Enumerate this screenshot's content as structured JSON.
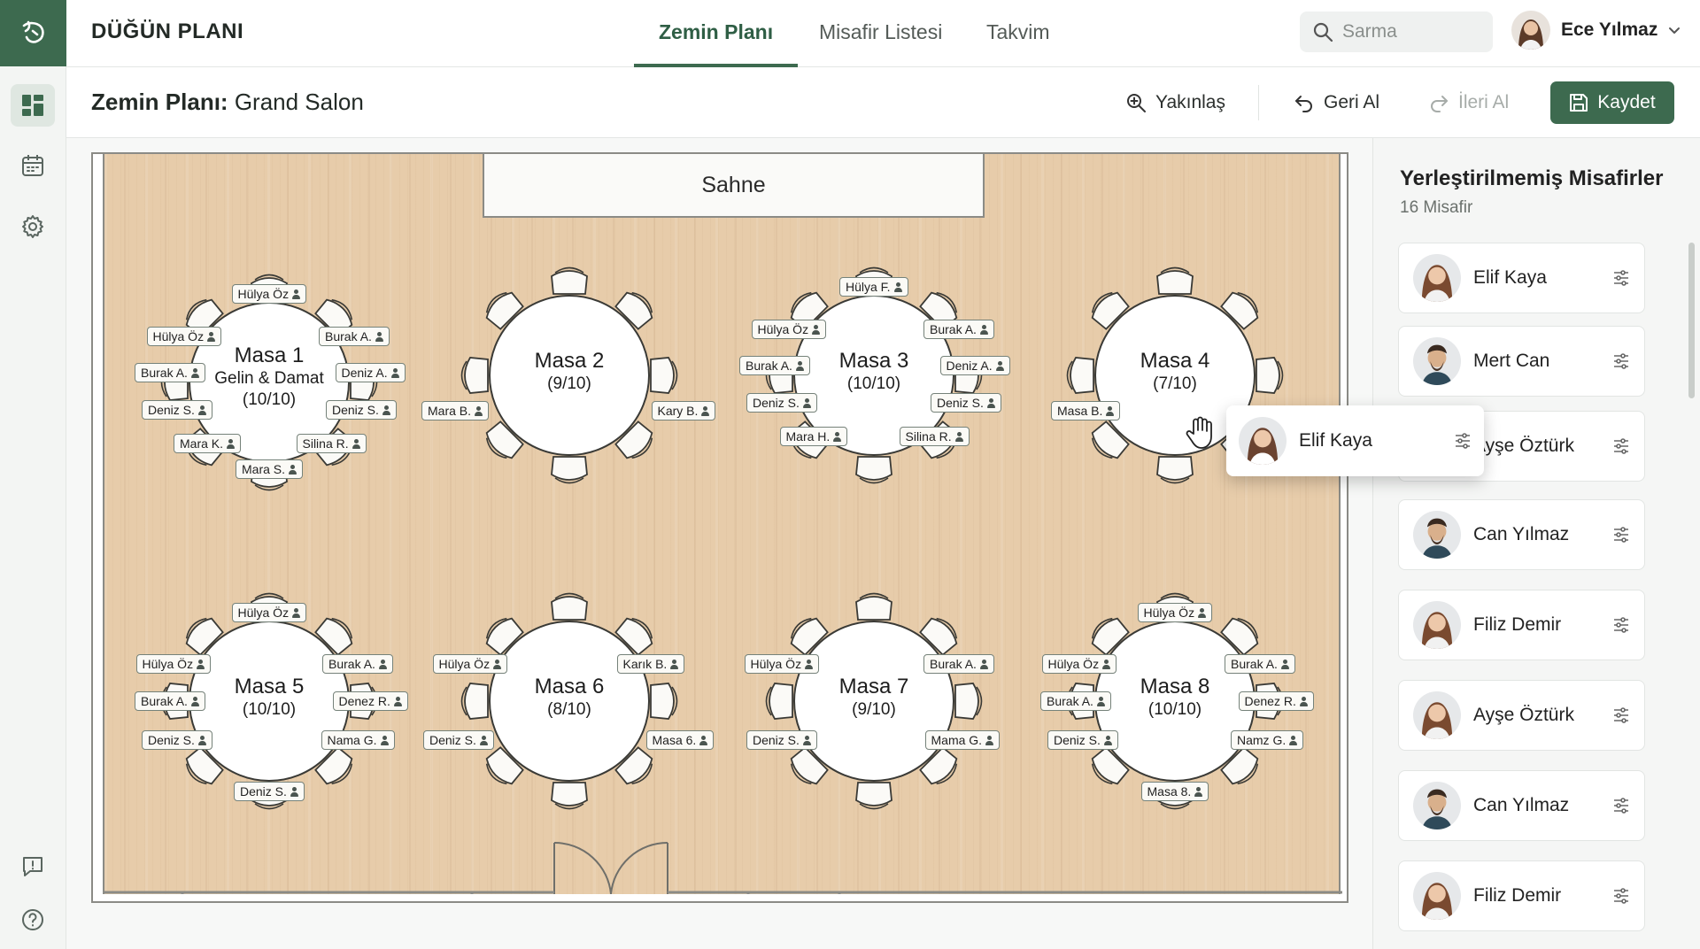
{
  "app": {
    "title": "DÜĞÜN PLANI"
  },
  "nav_tabs": [
    {
      "label": "Zemin Planı",
      "active": true
    },
    {
      "label": "Misafir Listesi",
      "active": false
    },
    {
      "label": "Takvim",
      "active": false
    }
  ],
  "search": {
    "placeholder": "Sarma"
  },
  "user": {
    "name": "Ece Yılmaz"
  },
  "toolbar": {
    "title_prefix": "Zemin Planı:",
    "title_venue": "Grand Salon",
    "zoom_label": "Yakınlaş",
    "undo_label": "Geri Al",
    "redo_label": "İleri Al",
    "save_label": "Kaydet"
  },
  "floor": {
    "stage_label": "Sahne"
  },
  "tables": [
    {
      "name": "Masa 1",
      "subtitle": "Gelin & Damat",
      "occupancy": "(10/10)",
      "guests": [
        "Hülya Öz",
        "Burak A.",
        "Deniz A.",
        "Deniz S.",
        "Silina R.",
        "Mara S.",
        "Mara K.",
        "Deniz S.",
        "Burak A.",
        "Hülya Öz"
      ]
    },
    {
      "name": "Masa 2",
      "subtitle": "",
      "occupancy": "(9/10)",
      "guests": [
        "Kary B.",
        "Mara B."
      ]
    },
    {
      "name": "Masa 3",
      "subtitle": "",
      "occupancy": "(10/10)",
      "guests": [
        "Hülya F.",
        "Burak A.",
        "Deniz A.",
        "Deniz S.",
        "Silina R.",
        "Mara H.",
        "Deniz S.",
        "Burak A.",
        "Hülya Öz"
      ]
    },
    {
      "name": "Masa 4",
      "subtitle": "",
      "occupancy": "(7/10)",
      "guests": [
        "Masa B."
      ]
    },
    {
      "name": "Masa 5",
      "subtitle": "",
      "occupancy": "(10/10)",
      "guests": [
        "Hülya Öz",
        "Burak A.",
        "Denez R.",
        "Nama G.",
        "Deniz S.",
        "Deniz S.",
        "Burak A.",
        "Hülya Öz"
      ]
    },
    {
      "name": "Masa 6",
      "subtitle": "",
      "occupancy": "(8/10)",
      "guests": [
        "Karık B.",
        "Masa 6.",
        "Deniz S.",
        "Hülya Öz"
      ]
    },
    {
      "name": "Masa 7",
      "subtitle": "",
      "occupancy": "(9/10)",
      "guests": [
        "Burak A.",
        "Mama G.",
        "Deniz S.",
        "Hülya Öz"
      ]
    },
    {
      "name": "Masa 8",
      "subtitle": "",
      "occupancy": "(10/10)",
      "guests": [
        "Hülya Öz",
        "Burak A.",
        "Denez R.",
        "Namz G.",
        "Masa 8.",
        "Deniz S.",
        "Burak A.",
        "Hülya Öz"
      ]
    }
  ],
  "drag_ghost": {
    "name": "Elif Kaya"
  },
  "panel": {
    "title": "Yerleştirilmemiş Misafirler",
    "count": "16 Misafir",
    "guests": [
      {
        "name": "Elif Kaya",
        "avatar": "female-avatar"
      },
      {
        "name": "Mert Can",
        "avatar": "male-avatar"
      },
      {
        "name": "Ayşe Öztürk",
        "avatar": "female-avatar"
      },
      {
        "name": "Can Yılmaz",
        "avatar": "male-avatar"
      },
      {
        "name": "Filiz Demir",
        "avatar": "female-avatar"
      },
      {
        "name": "Ayşe Öztürk",
        "avatar": "female-avatar"
      },
      {
        "name": "Can Yılmaz",
        "avatar": "male-avatar"
      },
      {
        "name": "Filiz Demir",
        "avatar": "female-avatar"
      }
    ]
  },
  "colors": {
    "primary": "#3d6a4f",
    "wood": "#e7ccaa",
    "stage": "#fafaf8"
  }
}
